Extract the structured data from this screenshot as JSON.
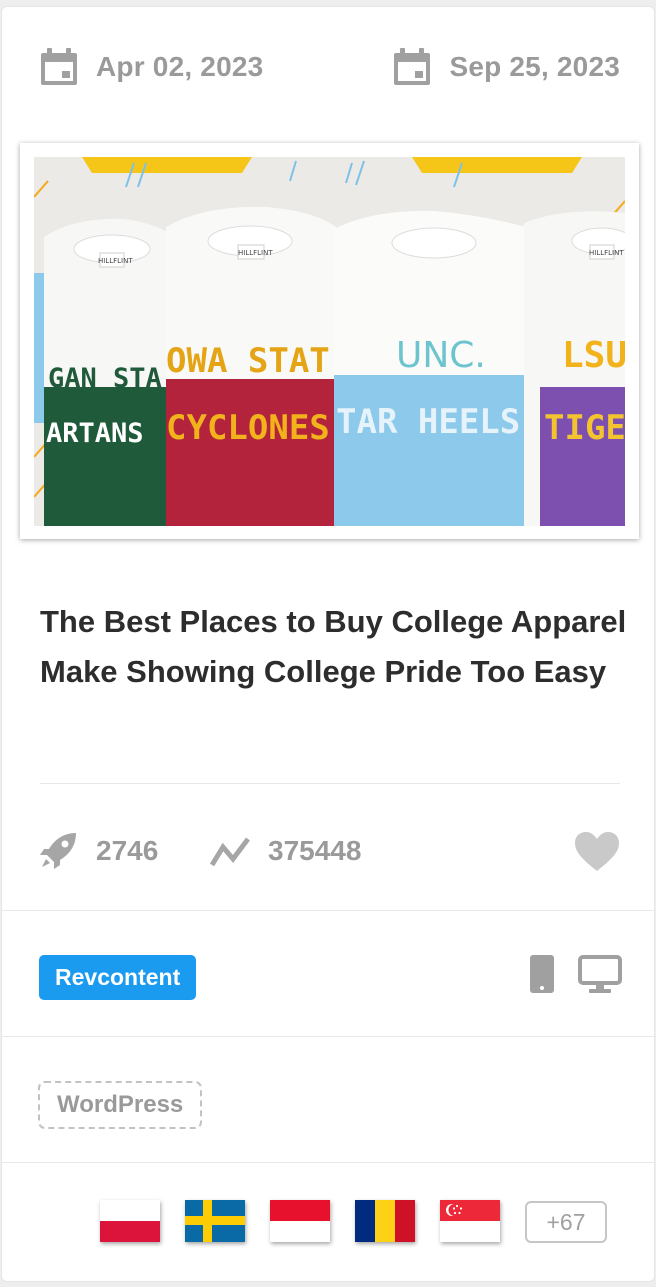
{
  "dates": {
    "start": "Apr 02, 2023",
    "end": "Sep 25, 2023",
    "icon": "calendar-icon"
  },
  "image": {
    "description_icon": "ad-image",
    "shirts": [
      {
        "top": "GAN STA",
        "bottom": "ARTANS",
        "color": "#1f5a3a",
        "text_color": "#ffffff"
      },
      {
        "top": "OWA STAT",
        "bottom": "CYCLONES",
        "color": "#b3243c",
        "text_color": "#f2b21b"
      },
      {
        "top": "UNC.",
        "bottom": "TAR HEELS",
        "color": "#8cc9ea",
        "text_color": "#e6f3fb"
      },
      {
        "top": "LSU",
        "bottom": "TIGE",
        "color": "#7d4fae",
        "text_color": "#f4c430"
      }
    ],
    "label_text": "HILLFLINT"
  },
  "title": "The Best Places to Buy College Apparel Make Showing College Pride Too Easy",
  "stats": {
    "votes": "2746",
    "votes_icon": "rocket-icon",
    "trend": "375448",
    "trend_icon": "trend-icon",
    "favorite_icon": "heart-icon"
  },
  "network": {
    "label": "Revcontent",
    "color": "#1a9bf0",
    "devices": [
      "mobile-icon",
      "desktop-icon"
    ]
  },
  "tag": "WordPress",
  "countries": {
    "flags": [
      "poland-flag",
      "sweden-flag",
      "monaco-flag",
      "romania-flag",
      "singapore-flag"
    ],
    "more": "+67"
  }
}
